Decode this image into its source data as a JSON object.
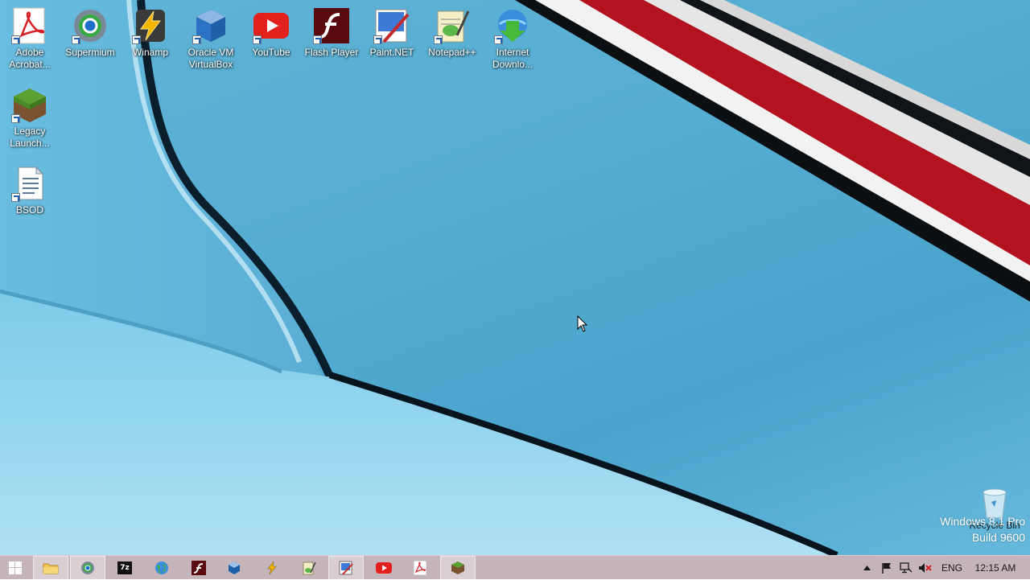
{
  "desktop": {
    "icons": [
      {
        "label": "Adobe Acrobat...",
        "icon": "adobe-acrobat-icon"
      },
      {
        "label": "Supermium",
        "icon": "supermium-icon"
      },
      {
        "label": "Winamp",
        "icon": "winamp-icon"
      },
      {
        "label": "Oracle VM VirtualBox",
        "icon": "virtualbox-icon"
      },
      {
        "label": "YouTube",
        "icon": "youtube-icon"
      },
      {
        "label": "Flash Player",
        "icon": "flash-player-icon"
      },
      {
        "label": "Paint.NET",
        "icon": "paintnet-icon"
      },
      {
        "label": "Notepad++",
        "icon": "notepadpp-icon"
      },
      {
        "label": "Internet Downlo...",
        "icon": "internet-download-manager-icon"
      },
      {
        "label": "Legacy Launch...",
        "icon": "legacy-launcher-icon"
      },
      {
        "label": "BSOD",
        "icon": "document-icon"
      }
    ],
    "recycle_bin_label": "Recycle Bin",
    "watermark": {
      "line1": "Windows 8.1 Pro",
      "line2": "Build 9600"
    }
  },
  "taskbar": {
    "start_icon": "windows-logo-icon",
    "pinned": [
      {
        "icon": "file-explorer-icon",
        "active": true
      },
      {
        "icon": "supermium-icon",
        "active": true
      },
      {
        "icon": "7zip-icon",
        "text": "7z",
        "active": false
      },
      {
        "icon": "globe-icon",
        "active": false
      },
      {
        "icon": "flash-player-icon",
        "active": false
      },
      {
        "icon": "virtualbox-icon",
        "active": false
      },
      {
        "icon": "winamp-icon",
        "active": false
      },
      {
        "icon": "notepadpp-icon",
        "active": false
      },
      {
        "icon": "paintnet-icon",
        "active": true
      },
      {
        "icon": "youtube-icon",
        "active": false
      },
      {
        "icon": "adobe-acrobat-icon",
        "active": false
      },
      {
        "icon": "minecraft-block-icon",
        "active": true
      }
    ],
    "tray": {
      "language": "ENG",
      "clock": "12:15 AM"
    }
  },
  "colors": {
    "taskbar": "#c5b4b9",
    "wallpaper": "#56add2",
    "accent_red": "#b3121f"
  }
}
